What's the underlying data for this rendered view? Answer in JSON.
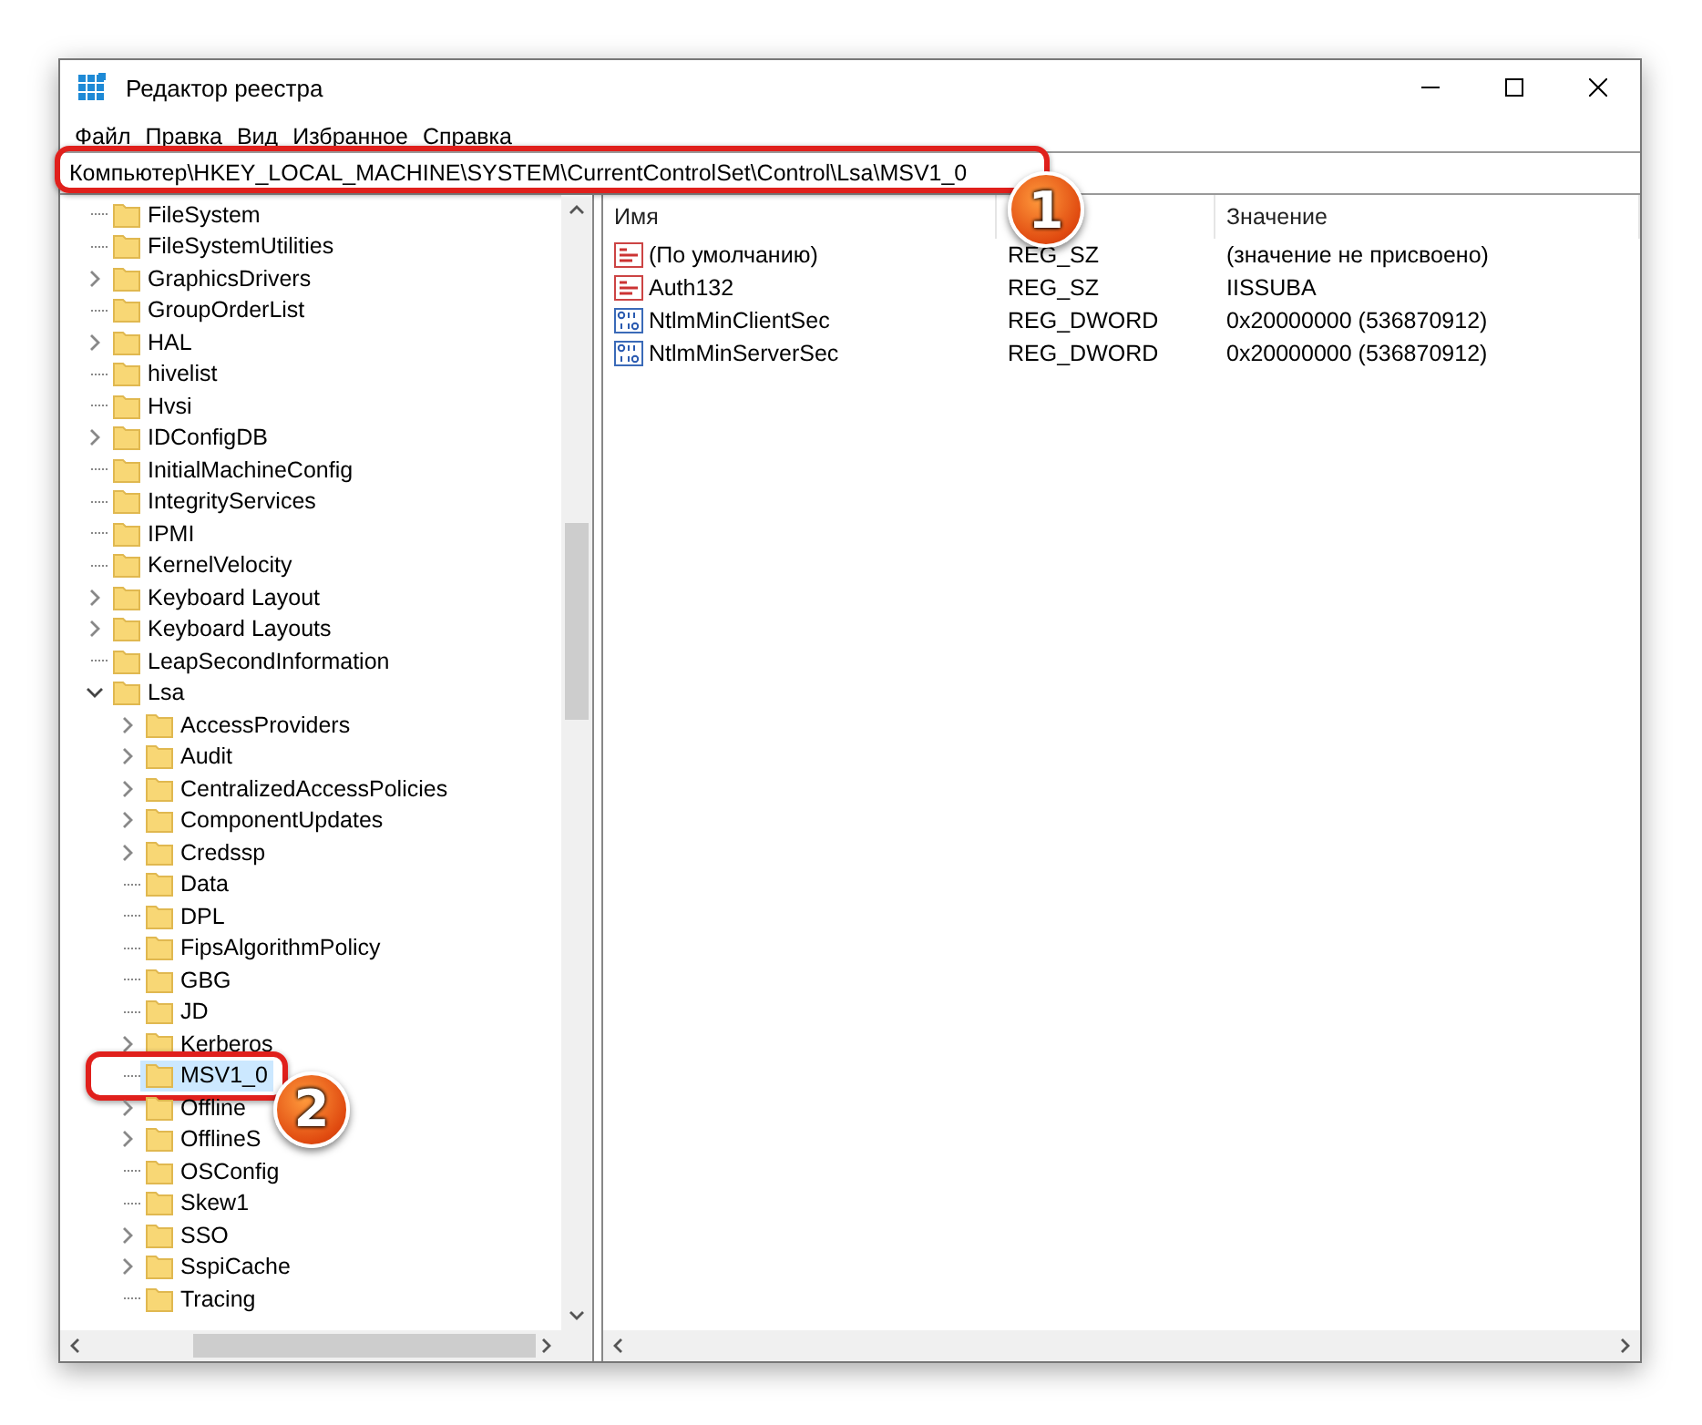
{
  "window": {
    "title": "Редактор реестра"
  },
  "menu": [
    {
      "label": "Файл"
    },
    {
      "label": "Правка"
    },
    {
      "label": "Вид"
    },
    {
      "label": "Избранное"
    },
    {
      "label": "Справка"
    }
  ],
  "address_bar": {
    "value": "Компьютер\\HKEY_LOCAL_MACHINE\\SYSTEM\\CurrentControlSet\\Control\\Lsa\\MSV1_0",
    "callout": "1"
  },
  "tree": [
    {
      "name": "FileSystem",
      "expandable": false,
      "selected": false
    },
    {
      "name": "FileSystemUtilities",
      "expandable": false,
      "selected": false
    },
    {
      "name": "GraphicsDrivers",
      "expandable": true,
      "expanded": false,
      "selected": false
    },
    {
      "name": "GroupOrderList",
      "expandable": false,
      "selected": false
    },
    {
      "name": "HAL",
      "expandable": true,
      "expanded": false,
      "selected": false
    },
    {
      "name": "hivelist",
      "expandable": false,
      "selected": false
    },
    {
      "name": "Hvsi",
      "expandable": false,
      "selected": false
    },
    {
      "name": "IDConfigDB",
      "expandable": true,
      "expanded": false,
      "selected": false
    },
    {
      "name": "InitialMachineConfig",
      "expandable": false,
      "selected": false
    },
    {
      "name": "IntegrityServices",
      "expandable": false,
      "selected": false
    },
    {
      "name": "IPMI",
      "expandable": false,
      "selected": false
    },
    {
      "name": "KernelVelocity",
      "expandable": false,
      "selected": false
    },
    {
      "name": "Keyboard Layout",
      "expandable": true,
      "expanded": false,
      "selected": false
    },
    {
      "name": "Keyboard Layouts",
      "expandable": true,
      "expanded": false,
      "selected": false
    },
    {
      "name": "LeapSecondInformation",
      "expandable": false,
      "selected": false
    },
    {
      "name": "Lsa",
      "expandable": true,
      "expanded": true,
      "selected": false,
      "children": [
        {
          "name": "AccessProviders",
          "expandable": true,
          "expanded": false,
          "selected": false
        },
        {
          "name": "Audit",
          "expandable": true,
          "expanded": false,
          "selected": false
        },
        {
          "name": "CentralizedAccessPolicies",
          "expandable": true,
          "expanded": false,
          "selected": false
        },
        {
          "name": "ComponentUpdates",
          "expandable": true,
          "expanded": false,
          "selected": false
        },
        {
          "name": "Credssp",
          "expandable": true,
          "expanded": false,
          "selected": false
        },
        {
          "name": "Data",
          "expandable": false,
          "selected": false
        },
        {
          "name": "DPL",
          "expandable": false,
          "selected": false
        },
        {
          "name": "FipsAlgorithmPolicy",
          "expandable": false,
          "selected": false
        },
        {
          "name": "GBG",
          "expandable": false,
          "selected": false
        },
        {
          "name": "JD",
          "expandable": false,
          "selected": false
        },
        {
          "name": "Kerberos",
          "expandable": true,
          "expanded": false,
          "selected": false
        },
        {
          "name": "MSV1_0",
          "expandable": false,
          "selected": true,
          "callout": "2"
        },
        {
          "name": "Offline",
          "expandable": true,
          "expanded": false,
          "selected": false
        },
        {
          "name": "OfflineS",
          "expandable": true,
          "expanded": false,
          "selected": false
        },
        {
          "name": "OSConfig",
          "expandable": false,
          "selected": false
        },
        {
          "name": "Skew1",
          "expandable": false,
          "selected": false
        },
        {
          "name": "SSO",
          "expandable": true,
          "expanded": false,
          "selected": false
        },
        {
          "name": "SspiCache",
          "expandable": true,
          "expanded": false,
          "selected": false
        },
        {
          "name": "Tracing",
          "expandable": false,
          "selected": false
        }
      ]
    }
  ],
  "table": {
    "columns": [
      "Имя",
      "",
      "Значение"
    ],
    "rows": [
      {
        "kind": "string",
        "name": "(По умолчанию)",
        "type": "REG_SZ",
        "value": "(значение не присвоено)"
      },
      {
        "kind": "string",
        "name": "Auth132",
        "type": "REG_SZ",
        "value": "IISSUBA"
      },
      {
        "kind": "binary",
        "name": "NtlmMinClientSec",
        "type": "REG_DWORD",
        "value": "0x20000000 (536870912)"
      },
      {
        "kind": "binary",
        "name": "NtlmMinServerSec",
        "type": "REG_DWORD",
        "value": "0x20000000 (536870912)"
      }
    ]
  }
}
